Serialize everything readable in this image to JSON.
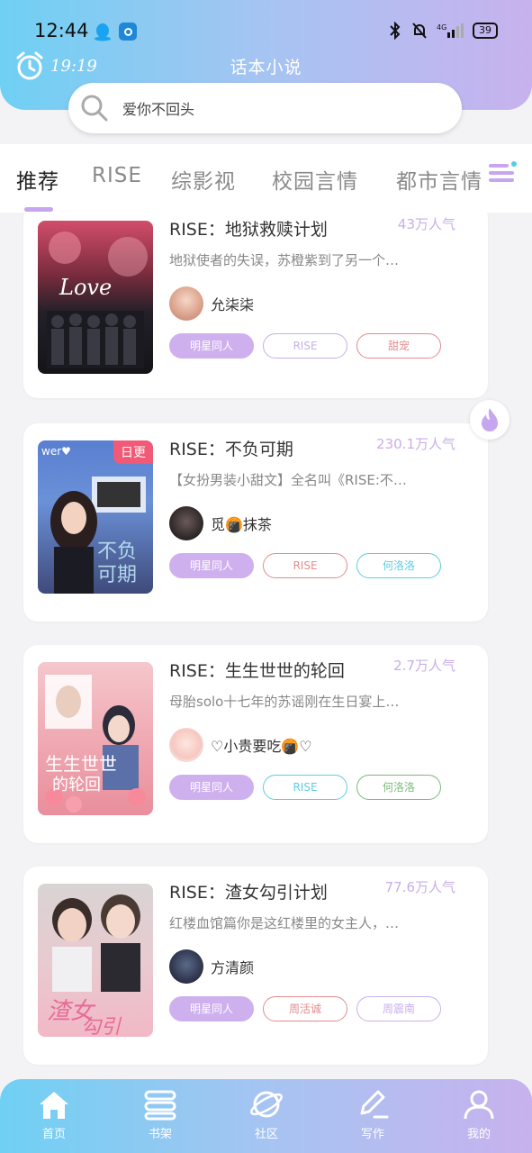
{
  "status_bar": {
    "time": "12:44",
    "battery": "39"
  },
  "header": {
    "alarm_time": "19:19",
    "app_title": "话本小说",
    "search_text": "爱你不回头"
  },
  "tabs": [
    {
      "label": "推荐",
      "active": true
    },
    {
      "label": "RISE",
      "active": false
    },
    {
      "label": "综影视",
      "active": false
    },
    {
      "label": "校园言情",
      "active": false
    },
    {
      "label": "都市言情",
      "active": false
    }
  ],
  "books": [
    {
      "title": "RISE：地狱救赎计划",
      "popularity": "43万人气",
      "desc": "地狱使者的失误，苏橙紫到了另一个…",
      "author": "允柒柒",
      "badge": "",
      "tags": [
        {
          "label": "明星同人",
          "style": "fill"
        },
        {
          "label": "RISE",
          "style": "purple"
        },
        {
          "label": "甜宠",
          "style": "pink"
        }
      ]
    },
    {
      "title": "RISE：不负可期",
      "popularity": "230.1万人气",
      "desc": "【女扮男装小甜文】全名叫《RISE:不…",
      "author": "觅🍘抹茶",
      "badge": "日更",
      "tags": [
        {
          "label": "明星同人",
          "style": "fill"
        },
        {
          "label": "RISE",
          "style": "pink"
        },
        {
          "label": "何洛洛",
          "style": "cyan"
        }
      ]
    },
    {
      "title": "RISE：生生世世的轮回",
      "popularity": "2.7万人气",
      "desc": "母胎solo十七年的苏谣刚在生日宴上…",
      "author": "♡小贵要吃🍘♡",
      "badge": "",
      "tags": [
        {
          "label": "明星同人",
          "style": "fill"
        },
        {
          "label": "RISE",
          "style": "cyan"
        },
        {
          "label": "何洛洛",
          "style": "green"
        }
      ]
    },
    {
      "title": "RISE：渣女勾引计划",
      "popularity": "77.6万人气",
      "desc": "红楼血馆篇你是这红楼里的女主人，…",
      "author": "方清颜",
      "badge": "",
      "tags": [
        {
          "label": "明星同人",
          "style": "fill"
        },
        {
          "label": "周活诚",
          "style": "pink"
        },
        {
          "label": "周震南",
          "style": "purple"
        }
      ]
    }
  ],
  "bottom_nav": [
    {
      "label": "首页",
      "icon": "home-icon"
    },
    {
      "label": "书架",
      "icon": "bookshelf-icon"
    },
    {
      "label": "社区",
      "icon": "planet-icon"
    },
    {
      "label": "写作",
      "icon": "pen-icon"
    },
    {
      "label": "我的",
      "icon": "user-icon"
    }
  ],
  "colors": {
    "accent": "#cfb0ee",
    "header_start": "#6fd0f3",
    "header_end": "#c8b2ee",
    "badge": "#f05a76"
  }
}
